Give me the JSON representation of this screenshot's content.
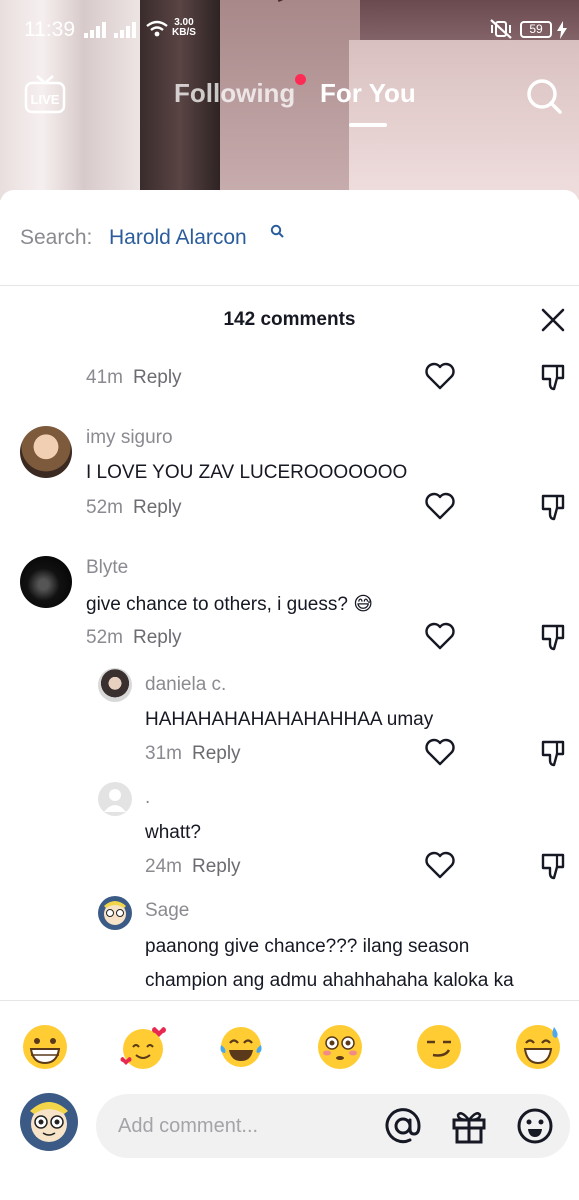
{
  "status_bar": {
    "time": "11:39",
    "net_speed_value": "3.00",
    "net_speed_unit": "KB/S",
    "battery": "59"
  },
  "top_nav": {
    "live_label": "LIVE",
    "tabs": [
      {
        "label": "Following",
        "active": false,
        "has_notification_dot": true
      },
      {
        "label": "For You",
        "active": true
      }
    ]
  },
  "search_suggestion": {
    "prefix": "Search:",
    "term": "Harold Alarcon"
  },
  "comments_header": {
    "count_label": "142 comments"
  },
  "comments": [
    {
      "id": "c0",
      "name": "",
      "text": "",
      "time": "41m",
      "reply_label": "Reply",
      "partial": true
    },
    {
      "id": "c1",
      "name": "imy siguro",
      "text": "I LOVE YOU ZAV LUCEROOOOOOO",
      "time": "52m",
      "reply_label": "Reply"
    },
    {
      "id": "c2",
      "name": "Blyte",
      "text": "give chance to others, i guess?",
      "emoji": "😅",
      "time": "52m",
      "reply_label": "Reply"
    },
    {
      "id": "r1",
      "name": "daniela c.",
      "text": "HAHAHAHAHAHAHAHHAA umay",
      "time": "31m",
      "reply_label": "Reply",
      "is_reply": true
    },
    {
      "id": "r2",
      "name": ".",
      "text": "whatt?",
      "time": "24m",
      "reply_label": "Reply",
      "is_reply": true
    },
    {
      "id": "r3",
      "name": "Sage",
      "text_line1": "paanong give chance??? ilang season",
      "text_line2": "champion ang admu ahahhahaha kaloka ka",
      "is_reply": true
    }
  ],
  "emoji_bar": [
    "😁",
    "🥰",
    "😂",
    "😳",
    "😏",
    "😅"
  ],
  "composer": {
    "placeholder": "Add comment..."
  },
  "colors": {
    "accent_red": "#fe2c55",
    "link_blue": "#2b5d9c",
    "muted_text": "#8a8b91"
  }
}
